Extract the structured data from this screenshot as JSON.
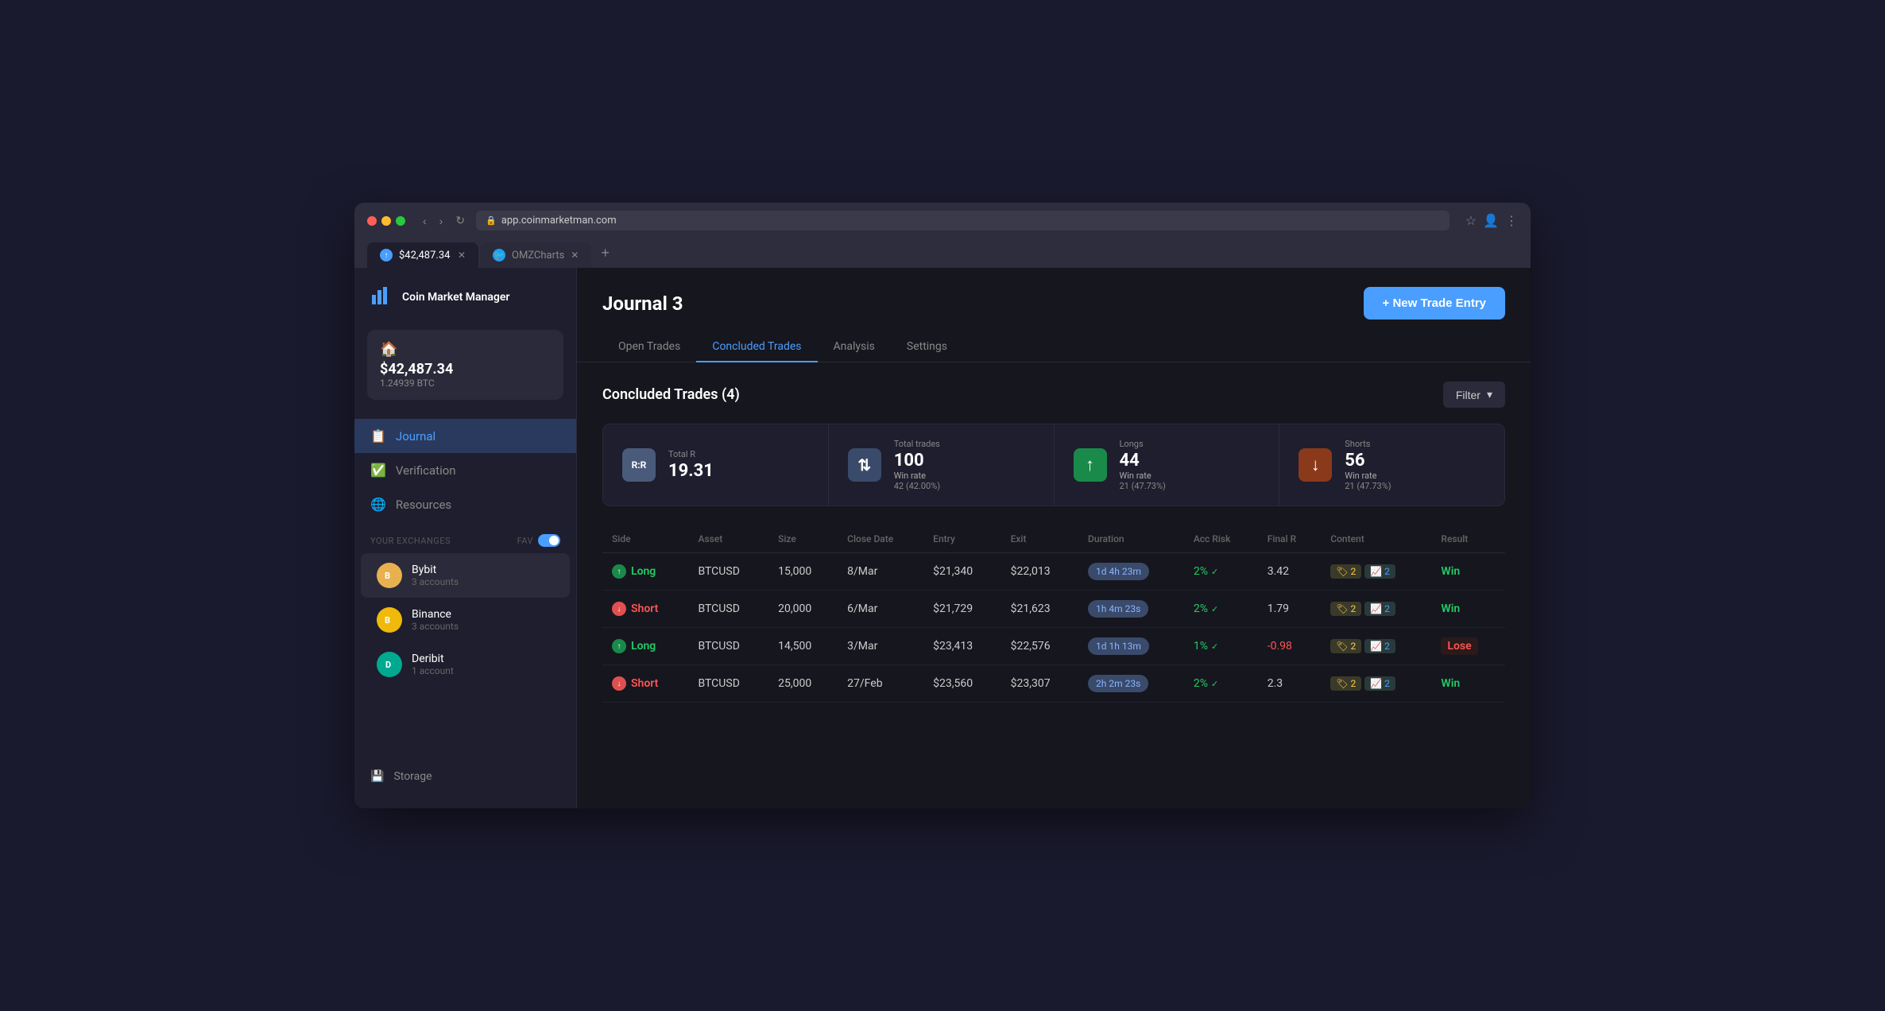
{
  "browser": {
    "url": "app.coinmarketman.com",
    "tabs": [
      {
        "id": "tab1",
        "favicon_color": "#4a9eff",
        "favicon_text": "●",
        "title": "$42,487.34",
        "active": true
      },
      {
        "id": "tab2",
        "favicon_color": "#1da1f2",
        "favicon_text": "🐦",
        "title": "OMZCharts",
        "active": false
      }
    ],
    "new_tab_label": "+"
  },
  "sidebar": {
    "logo_text": "Coin Market\nManager",
    "wallet": {
      "icon": "🏠",
      "amount": "$42,487.34",
      "btc": "1.24939 BTC"
    },
    "nav_items": [
      {
        "id": "journal",
        "icon": "📓",
        "label": "Journal",
        "active": true
      },
      {
        "id": "verification",
        "icon": "✅",
        "label": "Verification",
        "active": false
      },
      {
        "id": "resources",
        "icon": "🌐",
        "label": "Resources",
        "active": false
      }
    ],
    "exchanges_label": "YOUR EXCHANGES",
    "fav_label": "FAV",
    "exchanges": [
      {
        "id": "bybit",
        "name": "Bybit",
        "accounts": "3 accounts",
        "color": "#f7a600",
        "letter": "B"
      },
      {
        "id": "binance",
        "name": "Binance",
        "accounts": "3 accounts",
        "color": "#f0b90b",
        "letter": "B"
      },
      {
        "id": "deribit",
        "name": "Deribit",
        "accounts": "1 account",
        "color": "#02a991",
        "letter": "D"
      }
    ],
    "storage_label": "Storage"
  },
  "page": {
    "title": "Journal 3",
    "new_trade_btn": "+ New Trade Entry",
    "tabs": [
      {
        "id": "open",
        "label": "Open Trades",
        "active": false
      },
      {
        "id": "concluded",
        "label": "Concluded Trades",
        "active": true
      },
      {
        "id": "analysis",
        "label": "Analysis",
        "active": false
      },
      {
        "id": "settings",
        "label": "Settings",
        "active": false
      }
    ]
  },
  "concluded_trades": {
    "title": "Concluded Trades (4)",
    "filter_label": "Filter",
    "stats": [
      {
        "id": "rr",
        "icon_text": "R:R",
        "icon_class": "rr",
        "label": "Total R",
        "value": "19.31",
        "sub": ""
      },
      {
        "id": "total",
        "icon_text": "↑↓",
        "icon_class": "total",
        "label": "Total trades",
        "value": "100",
        "sub": "42 (42.00%)"
      },
      {
        "id": "longs",
        "icon_text": "↑",
        "icon_class": "longs",
        "label": "Longs",
        "value": "44",
        "sub": "21 (47.73%)"
      },
      {
        "id": "shorts",
        "icon_text": "↓",
        "icon_class": "shorts",
        "label": "Shorts",
        "value": "56",
        "sub": "21 (47.73%)"
      }
    ],
    "stats_win_rate_label": "Win rate",
    "columns": [
      "Side",
      "Asset",
      "Size",
      "Close Date",
      "Entry",
      "Exit",
      "Duration",
      "Acc Risk",
      "Final R",
      "Content",
      "Result"
    ],
    "rows": [
      {
        "side": "Long",
        "side_class": "long",
        "asset": "BTCUSD",
        "size": "15,000",
        "size_class": "size-long",
        "close_date": "8/Mar",
        "entry": "$21,340",
        "exit": "$22,013",
        "duration": "1d 4h 23m",
        "acc_risk": "2%",
        "final_r": "3.42",
        "content_tag": "2",
        "chart_tag": "2",
        "result": "Win",
        "result_class": "result-win"
      },
      {
        "side": "Short",
        "side_class": "short",
        "asset": "BTCUSD",
        "size": "20,000",
        "size_class": "size-short",
        "close_date": "6/Mar",
        "entry": "$21,729",
        "exit": "$21,623",
        "duration": "1h 4m 23s",
        "acc_risk": "2%",
        "final_r": "1.79",
        "content_tag": "2",
        "chart_tag": "2",
        "result": "Win",
        "result_class": "result-win"
      },
      {
        "side": "Long",
        "side_class": "long",
        "asset": "BTCUSD",
        "size": "14,500",
        "size_class": "size-long",
        "close_date": "3/Mar",
        "entry": "$23,413",
        "exit": "$22,576",
        "duration": "1d 1h 13m",
        "acc_risk": "1%",
        "final_r": "-0.98",
        "content_tag": "2",
        "chart_tag": "2",
        "result": "Lose",
        "result_class": "result-lose"
      },
      {
        "side": "Short",
        "side_class": "short",
        "asset": "BTCUSD",
        "size": "25,000",
        "size_class": "size-short",
        "close_date": "27/Feb",
        "entry": "$23,560",
        "exit": "$23,307",
        "duration": "2h 2m 23s",
        "acc_risk": "2%",
        "final_r": "2.3",
        "content_tag": "2",
        "chart_tag": "2",
        "result": "Win",
        "result_class": "result-win"
      }
    ]
  }
}
